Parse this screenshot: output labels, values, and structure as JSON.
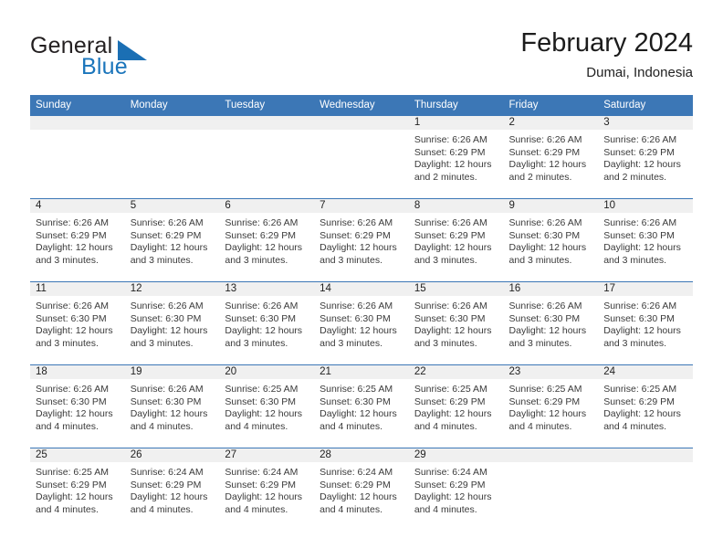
{
  "brand": {
    "name_part1": "General",
    "name_part2": "Blue",
    "logo_icon": "triangle-flag-icon",
    "accent_color": "#1b75bb"
  },
  "header": {
    "title": "February 2024",
    "subtitle": "Dumai, Indonesia",
    "header_bar_color": "#3c77b6",
    "daynum_band_color": "#f0f0f0"
  },
  "weekdays": [
    "Sunday",
    "Monday",
    "Tuesday",
    "Wednesday",
    "Thursday",
    "Friday",
    "Saturday"
  ],
  "labels": {
    "sunrise_prefix": "Sunrise:",
    "sunset_prefix": "Sunset:",
    "daylight_prefix": "Daylight:"
  },
  "weeks": [
    [
      {
        "day": "",
        "empty": true
      },
      {
        "day": "",
        "empty": true
      },
      {
        "day": "",
        "empty": true
      },
      {
        "day": "",
        "empty": true
      },
      {
        "day": "1",
        "sunrise": "Sunrise: 6:26 AM",
        "sunset": "Sunset: 6:29 PM",
        "daylight_l1": "Daylight: 12 hours",
        "daylight_l2": "and 2 minutes."
      },
      {
        "day": "2",
        "sunrise": "Sunrise: 6:26 AM",
        "sunset": "Sunset: 6:29 PM",
        "daylight_l1": "Daylight: 12 hours",
        "daylight_l2": "and 2 minutes."
      },
      {
        "day": "3",
        "sunrise": "Sunrise: 6:26 AM",
        "sunset": "Sunset: 6:29 PM",
        "daylight_l1": "Daylight: 12 hours",
        "daylight_l2": "and 2 minutes."
      }
    ],
    [
      {
        "day": "4",
        "sunrise": "Sunrise: 6:26 AM",
        "sunset": "Sunset: 6:29 PM",
        "daylight_l1": "Daylight: 12 hours",
        "daylight_l2": "and 3 minutes."
      },
      {
        "day": "5",
        "sunrise": "Sunrise: 6:26 AM",
        "sunset": "Sunset: 6:29 PM",
        "daylight_l1": "Daylight: 12 hours",
        "daylight_l2": "and 3 minutes."
      },
      {
        "day": "6",
        "sunrise": "Sunrise: 6:26 AM",
        "sunset": "Sunset: 6:29 PM",
        "daylight_l1": "Daylight: 12 hours",
        "daylight_l2": "and 3 minutes."
      },
      {
        "day": "7",
        "sunrise": "Sunrise: 6:26 AM",
        "sunset": "Sunset: 6:29 PM",
        "daylight_l1": "Daylight: 12 hours",
        "daylight_l2": "and 3 minutes."
      },
      {
        "day": "8",
        "sunrise": "Sunrise: 6:26 AM",
        "sunset": "Sunset: 6:29 PM",
        "daylight_l1": "Daylight: 12 hours",
        "daylight_l2": "and 3 minutes."
      },
      {
        "day": "9",
        "sunrise": "Sunrise: 6:26 AM",
        "sunset": "Sunset: 6:30 PM",
        "daylight_l1": "Daylight: 12 hours",
        "daylight_l2": "and 3 minutes."
      },
      {
        "day": "10",
        "sunrise": "Sunrise: 6:26 AM",
        "sunset": "Sunset: 6:30 PM",
        "daylight_l1": "Daylight: 12 hours",
        "daylight_l2": "and 3 minutes."
      }
    ],
    [
      {
        "day": "11",
        "sunrise": "Sunrise: 6:26 AM",
        "sunset": "Sunset: 6:30 PM",
        "daylight_l1": "Daylight: 12 hours",
        "daylight_l2": "and 3 minutes."
      },
      {
        "day": "12",
        "sunrise": "Sunrise: 6:26 AM",
        "sunset": "Sunset: 6:30 PM",
        "daylight_l1": "Daylight: 12 hours",
        "daylight_l2": "and 3 minutes."
      },
      {
        "day": "13",
        "sunrise": "Sunrise: 6:26 AM",
        "sunset": "Sunset: 6:30 PM",
        "daylight_l1": "Daylight: 12 hours",
        "daylight_l2": "and 3 minutes."
      },
      {
        "day": "14",
        "sunrise": "Sunrise: 6:26 AM",
        "sunset": "Sunset: 6:30 PM",
        "daylight_l1": "Daylight: 12 hours",
        "daylight_l2": "and 3 minutes."
      },
      {
        "day": "15",
        "sunrise": "Sunrise: 6:26 AM",
        "sunset": "Sunset: 6:30 PM",
        "daylight_l1": "Daylight: 12 hours",
        "daylight_l2": "and 3 minutes."
      },
      {
        "day": "16",
        "sunrise": "Sunrise: 6:26 AM",
        "sunset": "Sunset: 6:30 PM",
        "daylight_l1": "Daylight: 12 hours",
        "daylight_l2": "and 3 minutes."
      },
      {
        "day": "17",
        "sunrise": "Sunrise: 6:26 AM",
        "sunset": "Sunset: 6:30 PM",
        "daylight_l1": "Daylight: 12 hours",
        "daylight_l2": "and 3 minutes."
      }
    ],
    [
      {
        "day": "18",
        "sunrise": "Sunrise: 6:26 AM",
        "sunset": "Sunset: 6:30 PM",
        "daylight_l1": "Daylight: 12 hours",
        "daylight_l2": "and 4 minutes."
      },
      {
        "day": "19",
        "sunrise": "Sunrise: 6:26 AM",
        "sunset": "Sunset: 6:30 PM",
        "daylight_l1": "Daylight: 12 hours",
        "daylight_l2": "and 4 minutes."
      },
      {
        "day": "20",
        "sunrise": "Sunrise: 6:25 AM",
        "sunset": "Sunset: 6:30 PM",
        "daylight_l1": "Daylight: 12 hours",
        "daylight_l2": "and 4 minutes."
      },
      {
        "day": "21",
        "sunrise": "Sunrise: 6:25 AM",
        "sunset": "Sunset: 6:30 PM",
        "daylight_l1": "Daylight: 12 hours",
        "daylight_l2": "and 4 minutes."
      },
      {
        "day": "22",
        "sunrise": "Sunrise: 6:25 AM",
        "sunset": "Sunset: 6:29 PM",
        "daylight_l1": "Daylight: 12 hours",
        "daylight_l2": "and 4 minutes."
      },
      {
        "day": "23",
        "sunrise": "Sunrise: 6:25 AM",
        "sunset": "Sunset: 6:29 PM",
        "daylight_l1": "Daylight: 12 hours",
        "daylight_l2": "and 4 minutes."
      },
      {
        "day": "24",
        "sunrise": "Sunrise: 6:25 AM",
        "sunset": "Sunset: 6:29 PM",
        "daylight_l1": "Daylight: 12 hours",
        "daylight_l2": "and 4 minutes."
      }
    ],
    [
      {
        "day": "25",
        "sunrise": "Sunrise: 6:25 AM",
        "sunset": "Sunset: 6:29 PM",
        "daylight_l1": "Daylight: 12 hours",
        "daylight_l2": "and 4 minutes."
      },
      {
        "day": "26",
        "sunrise": "Sunrise: 6:24 AM",
        "sunset": "Sunset: 6:29 PM",
        "daylight_l1": "Daylight: 12 hours",
        "daylight_l2": "and 4 minutes."
      },
      {
        "day": "27",
        "sunrise": "Sunrise: 6:24 AM",
        "sunset": "Sunset: 6:29 PM",
        "daylight_l1": "Daylight: 12 hours",
        "daylight_l2": "and 4 minutes."
      },
      {
        "day": "28",
        "sunrise": "Sunrise: 6:24 AM",
        "sunset": "Sunset: 6:29 PM",
        "daylight_l1": "Daylight: 12 hours",
        "daylight_l2": "and 4 minutes."
      },
      {
        "day": "29",
        "sunrise": "Sunrise: 6:24 AM",
        "sunset": "Sunset: 6:29 PM",
        "daylight_l1": "Daylight: 12 hours",
        "daylight_l2": "and 4 minutes."
      },
      {
        "day": "",
        "empty": true
      },
      {
        "day": "",
        "empty": true
      }
    ]
  ]
}
